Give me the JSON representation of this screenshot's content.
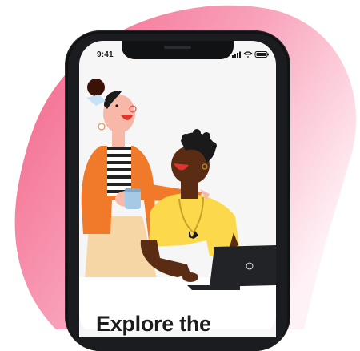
{
  "status_bar": {
    "time": "9:41",
    "icons": [
      "signal-icon",
      "wifi-icon",
      "battery-icon"
    ]
  },
  "onboarding": {
    "headline": "Explore the"
  },
  "colors": {
    "blob_pink": "#f25f84",
    "phone_frame": "#111214",
    "screen_bg": "#f6f6f6",
    "orange_jacket": "#f07a2a",
    "yellow_shirt": "#fcd94a",
    "laptop": "#222326"
  }
}
